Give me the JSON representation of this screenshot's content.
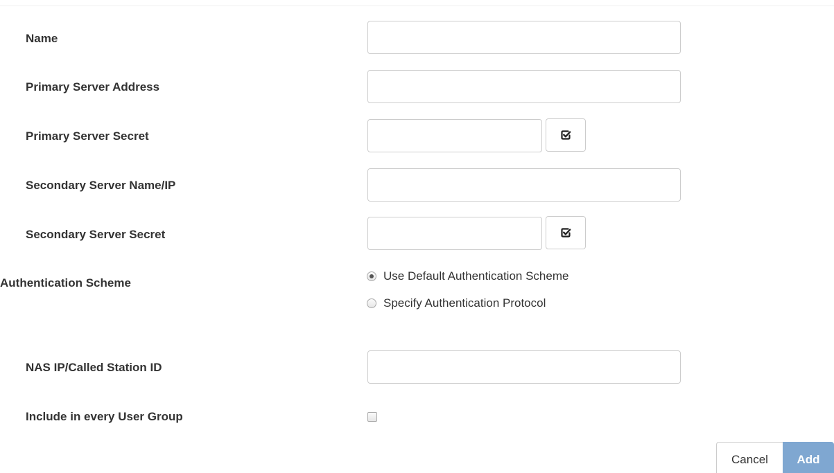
{
  "form": {
    "name": {
      "label": "Name",
      "value": "",
      "placeholder": ""
    },
    "primary_server_address": {
      "label": "Primary Server Address",
      "value": "",
      "placeholder": ""
    },
    "primary_server_secret": {
      "label": "Primary Server Secret",
      "value": "",
      "placeholder": ""
    },
    "secondary_server_name": {
      "label": "Secondary Server Name/IP",
      "value": "",
      "placeholder": ""
    },
    "secondary_server_secret": {
      "label": "Secondary Server Secret",
      "value": "",
      "placeholder": ""
    },
    "authentication_scheme": {
      "label": "Authentication Scheme",
      "options": [
        {
          "label": "Use Default Authentication Scheme",
          "selected": true
        },
        {
          "label": "Specify Authentication Protocol",
          "selected": false
        }
      ]
    },
    "nas_ip": {
      "label": "NAS IP/Called Station ID",
      "value": "",
      "placeholder": ""
    },
    "include_every_group": {
      "label": "Include in every User Group",
      "checked": false
    }
  },
  "icons": {
    "reveal_secret": "checkbox-check-icon"
  },
  "actions": {
    "cancel_label": "Cancel",
    "add_label": "Add"
  },
  "colors": {
    "primary_button": "#7fa7d1",
    "border": "#cccccc",
    "label_text": "#333333"
  }
}
